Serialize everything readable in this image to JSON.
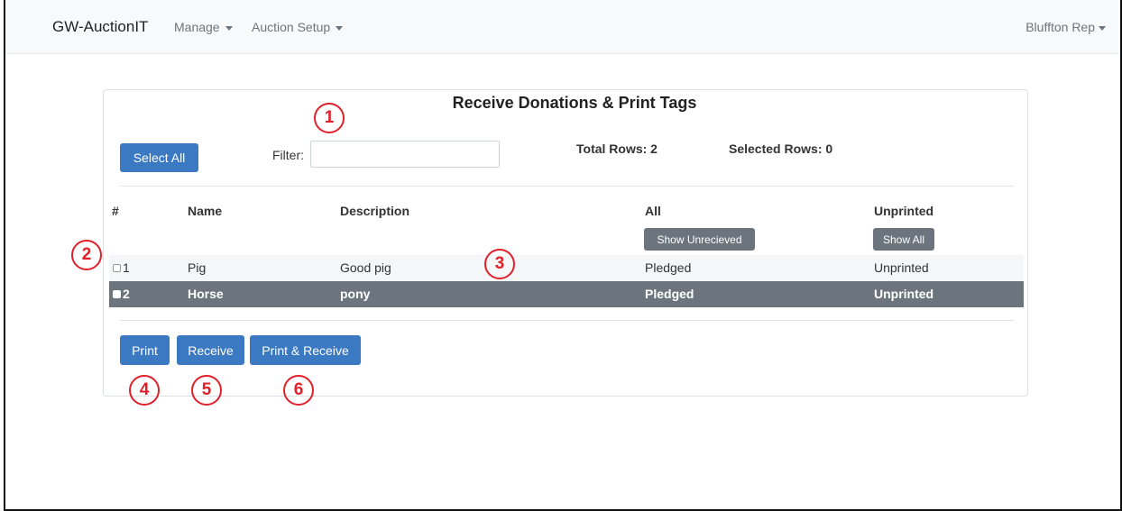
{
  "nav": {
    "brand": "GW-AuctionIT",
    "menu": [
      {
        "label": "Manage"
      },
      {
        "label": "Auction Setup"
      }
    ],
    "user": "Bluffton Rep"
  },
  "card": {
    "title": "Receive Donations & Print Tags",
    "select_all_label": "Select All",
    "filter_label": "Filter:",
    "filter_value": "",
    "filter_placeholder": "",
    "total_rows": "Total Rows: 2",
    "selected_rows": "Selected Rows: 0"
  },
  "table": {
    "headers": {
      "num": "#",
      "name": "Name",
      "description": "Description",
      "status": "All",
      "print_status": "Unprinted"
    },
    "status_filter_button": "Show Unrecieved",
    "print_filter_button": "Show All",
    "rows": [
      {
        "num": "1",
        "name": "Pig",
        "description": "Good pig",
        "status": "Pledged",
        "print_status": "Unprinted",
        "selected": false
      },
      {
        "num": "2",
        "name": "Horse",
        "description": "pony",
        "status": "Pledged",
        "print_status": "Unprinted",
        "selected": true
      }
    ]
  },
  "actions": {
    "print": "Print",
    "receive": "Receive",
    "print_receive": "Print & Receive"
  },
  "annotations": {
    "markers": [
      "1",
      "2",
      "3",
      "4",
      "5",
      "6"
    ],
    "color": "#e0202a"
  },
  "colors": {
    "primary": "#3b79c3",
    "selected_row": "#6c757d"
  }
}
